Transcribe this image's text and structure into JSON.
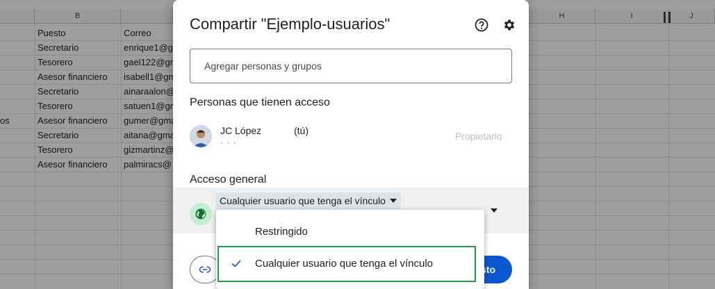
{
  "sheet": {
    "column_headers": [
      "B",
      "H",
      "I",
      "J"
    ],
    "header_row": {
      "puesto": "Puesto",
      "correo": "Correo"
    },
    "rows": [
      {
        "a": "",
        "puesto": "Secretario",
        "correo": "enrique1@gm"
      },
      {
        "a": "",
        "puesto": "Tesorero",
        "correo": "gael122@gm"
      },
      {
        "a": "",
        "puesto": "Asesor financiero",
        "correo": "isabell1@gm"
      },
      {
        "a": "",
        "puesto": "Secretario",
        "correo": "ainaraalon@"
      },
      {
        "a": "",
        "puesto": "Tesorero",
        "correo": "satuen1@gm"
      },
      {
        "a": "os",
        "puesto": "Asesor financiero",
        "correo": "gumer@gma"
      },
      {
        "a": "",
        "puesto": "Secretario",
        "correo": "aitana@gma"
      },
      {
        "a": "",
        "puesto": "Tesorero",
        "correo": "gizmartinz@"
      },
      {
        "a": "",
        "puesto": "Asesor financiero",
        "correo": "palmiracs@"
      }
    ]
  },
  "dialog": {
    "title": "Compartir \"Ejemplo-usuarios\"",
    "help_icon": "help-circle-icon",
    "settings_icon": "gear-icon",
    "add_people_placeholder": "Agregar personas y grupos",
    "people_section_title": "Personas que tienen acceso",
    "owner": {
      "name": "JC López",
      "you_label": "(tú)",
      "email": "·  ·  ·",
      "role": "Propietario"
    },
    "general_access_title": "Acceso general",
    "access_selected": "Cualquier usuario que tenga el vínculo",
    "done_label_visible": "isto",
    "link_icon": "link-icon",
    "globe_icon": "globe-icon"
  },
  "menu": {
    "options": [
      {
        "label": "Restringido",
        "selected": false
      },
      {
        "label": "Cualquier usuario que tenga el vínculo",
        "selected": true
      }
    ]
  },
  "colors": {
    "primary": "#0b57d0",
    "highlight_border": "#1e9e3e",
    "globe_bg": "#c4eed0"
  }
}
